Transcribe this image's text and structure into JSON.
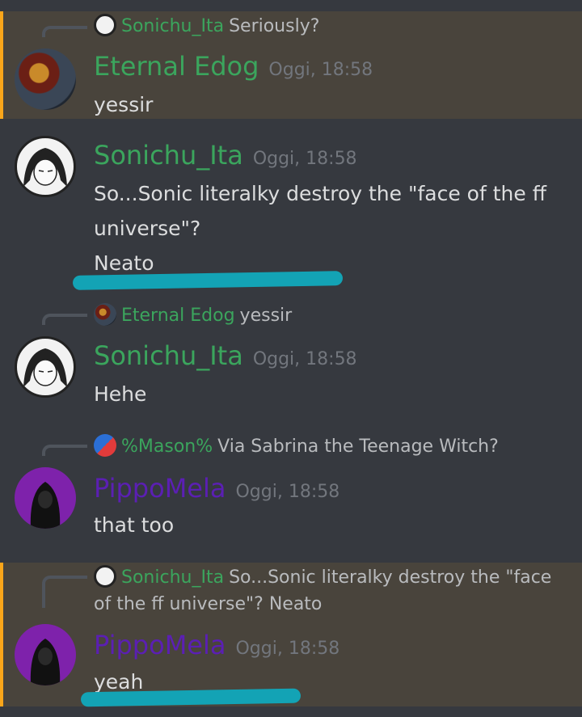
{
  "messages": [
    {
      "reply": {
        "author": "Sonichu_Ita",
        "text": "Seriously?"
      },
      "author": "Eternal Edog",
      "timestamp": "Oggi, 18:58",
      "lines": [
        "yessir"
      ],
      "highlighted": true
    },
    {
      "author": "Sonichu_Ita",
      "timestamp": "Oggi, 18:58",
      "lines": [
        "So...Sonic literalky destroy the \"face of the ff",
        "universe\"?",
        "Neato"
      ]
    },
    {
      "reply": {
        "author": "Eternal Edog",
        "text": "yessir"
      },
      "author": "Sonichu_Ita",
      "timestamp": "Oggi, 18:58",
      "lines": [
        "Hehe"
      ]
    },
    {
      "reply": {
        "author": "%Mason%",
        "text": "Via Sabrina the Teenage Witch?"
      },
      "author": "PippoMela",
      "timestamp": "Oggi, 18:58",
      "lines": [
        "that too"
      ]
    },
    {
      "reply": {
        "author": "Sonichu_Ita",
        "text": "So...Sonic literalky destroy the \"face of the ff universe\"? Neato"
      },
      "author": "PippoMela",
      "timestamp": "Oggi, 18:58",
      "lines": [
        "yeah"
      ],
      "highlighted": true
    }
  ],
  "colors": {
    "background": "#36393f",
    "highlight": "#49443c",
    "mention_bar": "#faa61a",
    "green_name": "#3ba55d",
    "purple_name": "#5b1fb3",
    "annotation": "#13a3b5"
  }
}
